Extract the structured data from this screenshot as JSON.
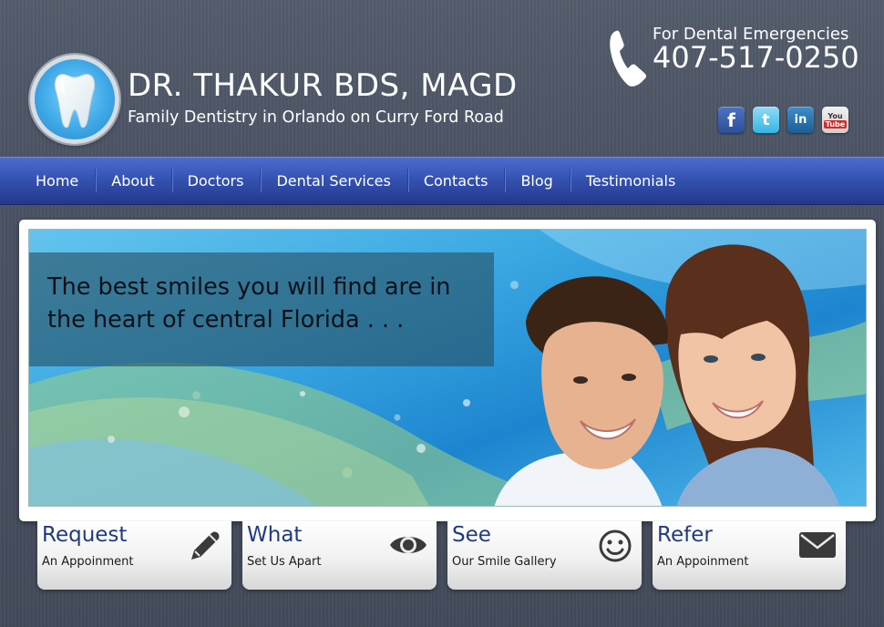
{
  "header": {
    "title": "DR. THAKUR BDS, MAGD",
    "subtitle": "Family Dentistry in Orlando on Curry Ford Road",
    "logo_icon": "tooth-icon",
    "emergency_label": "For Dental Emergencies",
    "emergency_phone": "407-517-0250",
    "phone_icon": "phone-handset-icon",
    "social": [
      {
        "name": "facebook",
        "glyph": "f"
      },
      {
        "name": "twitter",
        "glyph": "t"
      },
      {
        "name": "linkedin",
        "glyph": "in"
      },
      {
        "name": "youtube",
        "glyph_top": "You",
        "glyph_bottom": "Tube"
      }
    ]
  },
  "nav": {
    "items": [
      {
        "label": "Home"
      },
      {
        "label": "About"
      },
      {
        "label": "Doctors"
      },
      {
        "label": "Dental Services"
      },
      {
        "label": "Contacts"
      },
      {
        "label": "Blog"
      },
      {
        "label": "Testimonials"
      }
    ]
  },
  "banner": {
    "caption": "The best smiles you will find are in the heart of central Florida . . .",
    "caption_line1": "The best smiles you will find are in",
    "caption_line2": "the heart of central Florida . . ."
  },
  "cards": [
    {
      "title": "Request",
      "subtitle": "An Appoinment",
      "icon": "pencil-icon"
    },
    {
      "title": "What",
      "subtitle": "Set Us Apart",
      "icon": "eye-icon"
    },
    {
      "title": "See",
      "subtitle": "Our Smile Gallery",
      "icon": "smiley-icon"
    },
    {
      "title": "Refer",
      "subtitle": "An Appoinment",
      "icon": "envelope-icon"
    }
  ],
  "colors": {
    "background": "#4b5364",
    "nav": "#3553b3",
    "card_title": "#203a7e"
  }
}
